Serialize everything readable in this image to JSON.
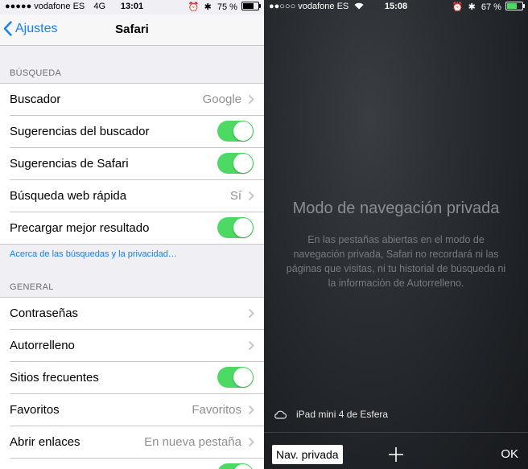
{
  "left": {
    "status": {
      "carrier": "●●●●● vodafone ES",
      "network": "4G",
      "time": "13:01",
      "battery": "75 %",
      "battery_level": 0.75
    },
    "nav": {
      "back_label": "Ajustes",
      "title": "Safari"
    },
    "search_section": {
      "header": "BÚSQUEDA",
      "rows": [
        {
          "label": "Buscador",
          "value": "Google"
        },
        {
          "label": "Sugerencias del buscador"
        },
        {
          "label": "Sugerencias de Safari"
        },
        {
          "label": "Búsqueda web rápida",
          "value": "Sí"
        },
        {
          "label": "Precargar mejor resultado"
        }
      ],
      "footer_link": "Acerca de las búsquedas y la privacidad…"
    },
    "general_section": {
      "header": "GENERAL",
      "rows": [
        {
          "label": "Contraseñas"
        },
        {
          "label": "Autorrelleno"
        },
        {
          "label": "Sitios frecuentes"
        },
        {
          "label": "Favoritos",
          "value": "Favoritos"
        },
        {
          "label": "Abrir enlaces",
          "value": "En nueva pestaña"
        }
      ]
    },
    "colors": {
      "accent": "#157efb",
      "toggle_on": "#4cd964"
    }
  },
  "right": {
    "status": {
      "carrier": "●●○○○ vodafone ES",
      "time": "15:08",
      "battery": "67 %",
      "battery_level": 0.67
    },
    "private_title": "Modo de navegación privada",
    "private_text": "En las pestañas abiertas en el modo de navegación privada, Safari no recordará ni las páginas que visitas, ni tu historial de búsqueda ni la información de Autorrelleno.",
    "device_name": "iPad mini 4 de Esfera",
    "toolbar": {
      "private_button": "Nav. privada",
      "ok_label": "OK"
    }
  }
}
